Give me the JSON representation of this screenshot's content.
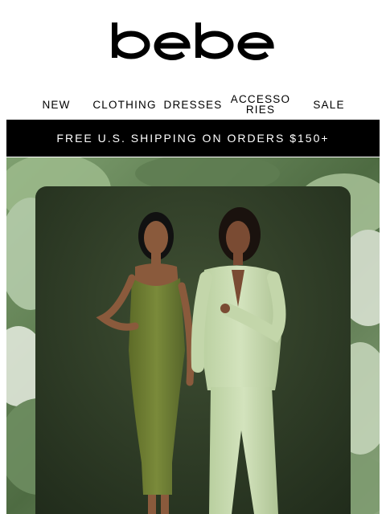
{
  "brand": {
    "logo_text": "bebe"
  },
  "nav": {
    "items": [
      {
        "label": "NEW"
      },
      {
        "label": "CLOTHING"
      },
      {
        "label": "DRESSES"
      },
      {
        "label": "ACCESSORIES"
      },
      {
        "label": "SALE"
      }
    ]
  },
  "banner": {
    "text": "FREE U.S. SHIPPING ON ORDERS $150+"
  },
  "hero": {
    "image": "two-models-green-outfits"
  },
  "colors": {
    "banner_bg": "#000000",
    "backdrop": "#3a4a30",
    "dress": "#6f7f32",
    "suit": "#c9dcb0"
  }
}
